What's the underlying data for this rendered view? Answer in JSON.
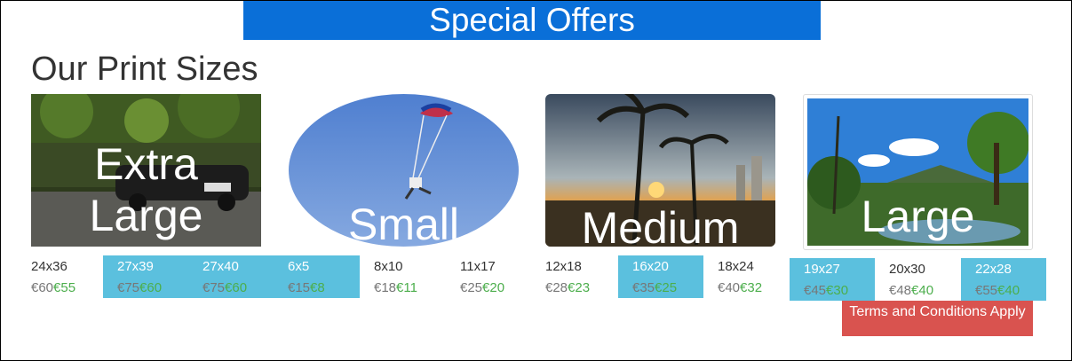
{
  "banner": {
    "text": "Special Offers"
  },
  "heading": "Our Print Sizes",
  "products": [
    {
      "label": "Extra Large",
      "sizes": [
        {
          "size": "24x36",
          "old": "€60",
          "new": "€55",
          "highlight": false
        },
        {
          "size": "27x39",
          "old": "€75",
          "new": "€60",
          "highlight": true
        },
        {
          "size": "27x40",
          "old": "€75",
          "new": "€60",
          "highlight": true
        }
      ]
    },
    {
      "label": "Small",
      "sizes": [
        {
          "size": "6x5",
          "old": "€15",
          "new": "€8",
          "highlight": true
        },
        {
          "size": "8x10",
          "old": "€18",
          "new": "€11",
          "highlight": false
        },
        {
          "size": "11x17",
          "old": "€25",
          "new": "€20",
          "highlight": false
        }
      ]
    },
    {
      "label": "Medium",
      "sizes": [
        {
          "size": "12x18",
          "old": "€28",
          "new": "€23",
          "highlight": false
        },
        {
          "size": "16x20",
          "old": "€35",
          "new": "€25",
          "highlight": true
        },
        {
          "size": "18x24",
          "old": "€40",
          "new": "€32",
          "highlight": false
        }
      ]
    },
    {
      "label": "Large",
      "sizes": [
        {
          "size": "19x27",
          "old": "€45",
          "new": "€30",
          "highlight": true
        },
        {
          "size": "20x30",
          "old": "€48",
          "new": "€40",
          "highlight": false
        },
        {
          "size": "22x28",
          "old": "€55",
          "new": "€40",
          "highlight": true
        }
      ]
    }
  ],
  "terms": "Terms and Conditions Apply",
  "colors": {
    "banner": "#0a6fd8",
    "highlight": "#5bc0de",
    "price_new": "#4cae4c",
    "price_old": "#777777",
    "terms": "#d9534f"
  }
}
